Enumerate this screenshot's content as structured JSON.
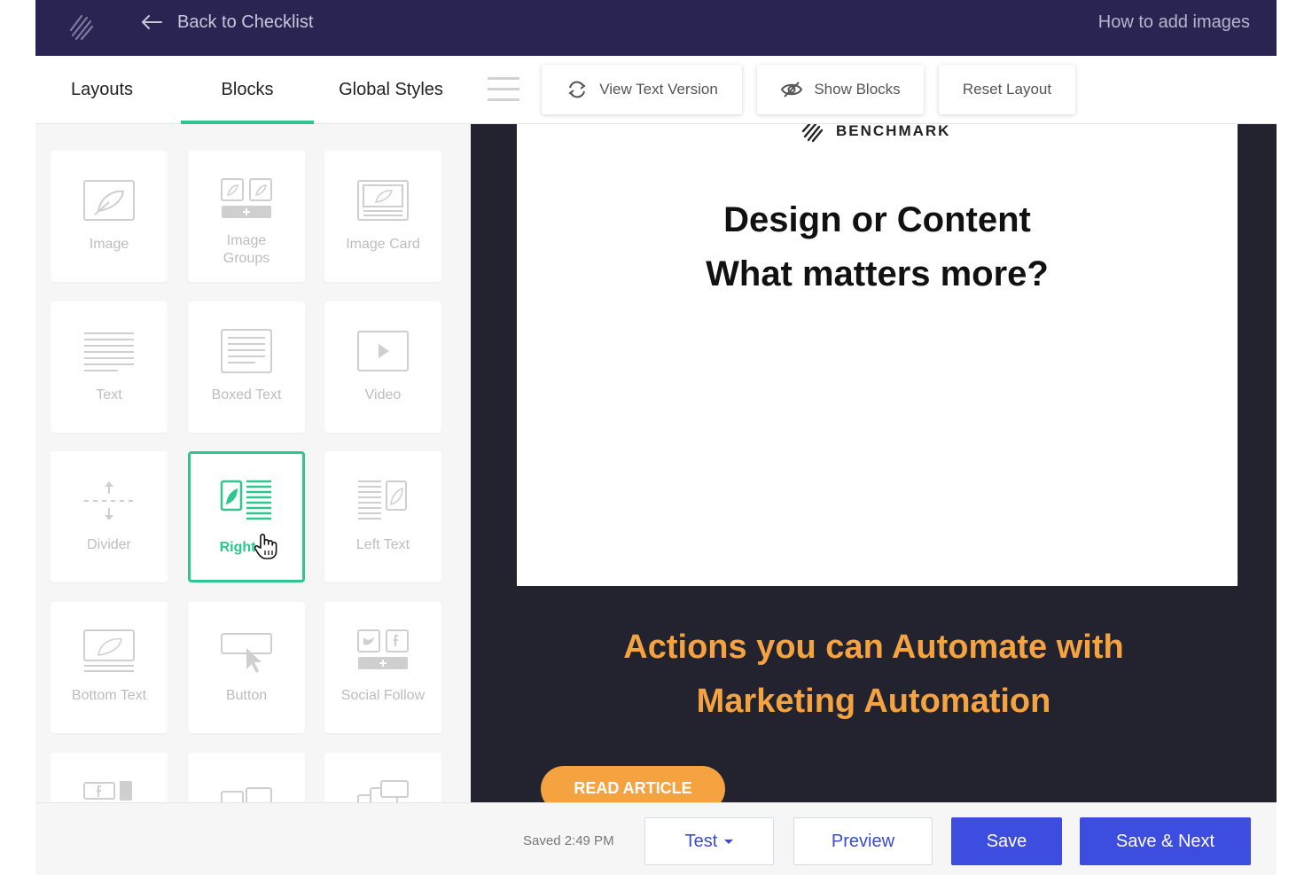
{
  "topbar": {
    "back_label": "Back to Checklist",
    "help_label": "How to add images"
  },
  "tabs": [
    {
      "label": "Layouts"
    },
    {
      "label": "Blocks",
      "active": true
    },
    {
      "label": "Global Styles"
    }
  ],
  "toolbar": {
    "view_text_label": "View Text Version",
    "show_blocks_label": "Show Blocks",
    "reset_layout_label": "Reset Layout"
  },
  "blocks": [
    {
      "label": "Image",
      "icon": "image-icon"
    },
    {
      "label": "Image\nGroups",
      "icon": "image-groups-icon"
    },
    {
      "label": "Image Card",
      "icon": "image-card-icon"
    },
    {
      "label": "Text",
      "icon": "text-icon"
    },
    {
      "label": "Boxed Text",
      "icon": "boxed-text-icon"
    },
    {
      "label": "Video",
      "icon": "video-icon"
    },
    {
      "label": "Divider",
      "icon": "divider-icon"
    },
    {
      "label": "Right Text",
      "icon": "right-text-icon",
      "active": true
    },
    {
      "label": "Left Text",
      "icon": "left-text-icon"
    },
    {
      "label": "Bottom Text",
      "icon": "bottom-text-icon"
    },
    {
      "label": "Button",
      "icon": "button-icon"
    },
    {
      "label": "Social Follow",
      "icon": "social-follow-icon"
    }
  ],
  "active_block_visible_label": "Right",
  "preview": {
    "brand": "BENCHMARK",
    "headline_line1": "Design or Content",
    "headline_line2": "What matters more?",
    "subheadline_line1": "Actions you can Automate with",
    "subheadline_line2": "Marketing Automation",
    "cta_label": "READ ARTICLE"
  },
  "bottombar": {
    "saved_status": "Saved 2:49 PM",
    "test_label": "Test",
    "preview_label": "Preview",
    "save_label": "Save",
    "save_next_label": "Save & Next"
  },
  "colors": {
    "topbar_bg": "#2a2452",
    "accent_green": "#2ec58e",
    "canvas_bg": "#22232e",
    "cta_orange": "#f4a340",
    "primary_blue": "#3d4de0"
  }
}
